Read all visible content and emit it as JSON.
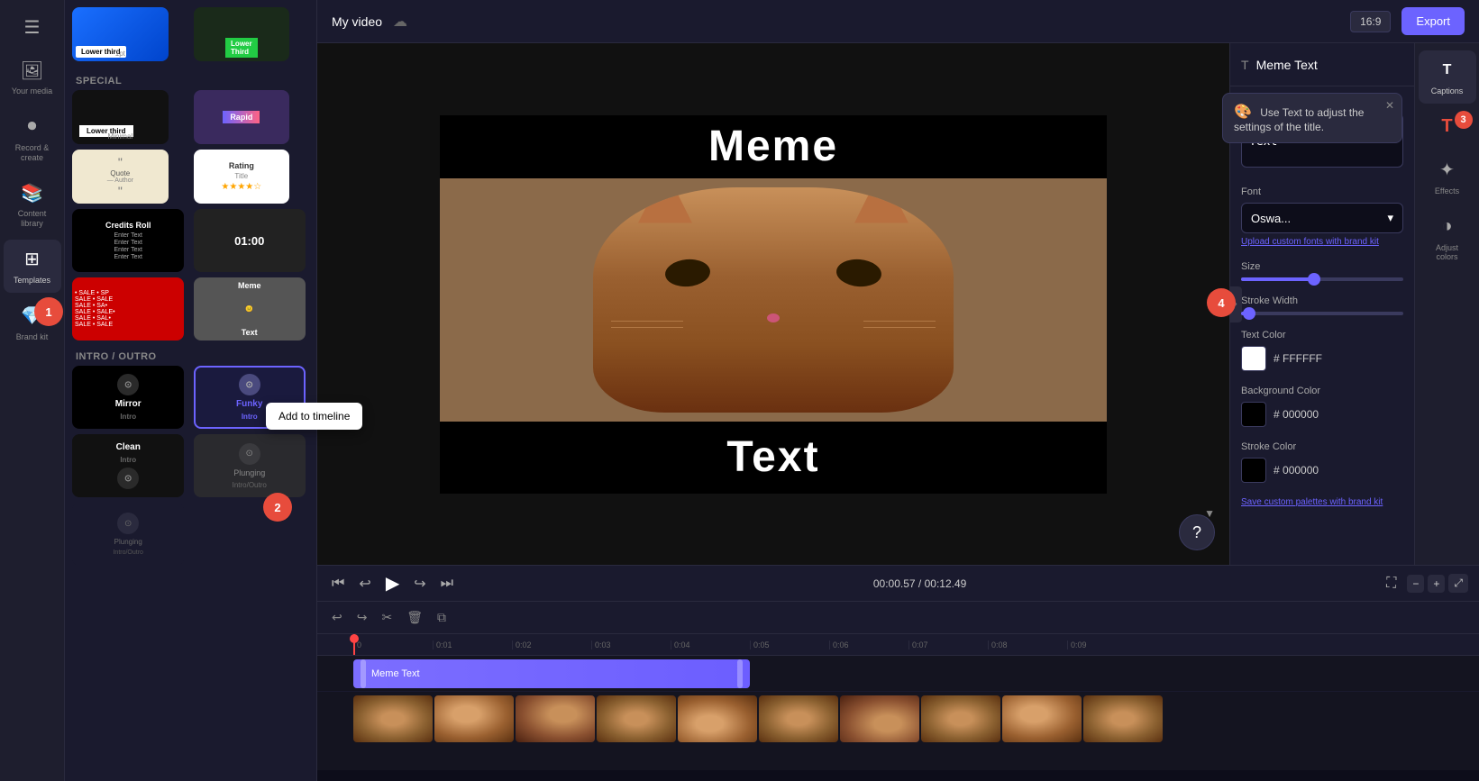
{
  "app": {
    "title": "My video",
    "export_label": "Export",
    "aspect_ratio": "16:9"
  },
  "sidebar": {
    "items": [
      {
        "id": "menu",
        "icon": "☰",
        "label": ""
      },
      {
        "id": "your-media",
        "icon": "🖼",
        "label": "Your media"
      },
      {
        "id": "record",
        "icon": "⏺",
        "label": "Record &\ncreate"
      },
      {
        "id": "content-library",
        "icon": "📚",
        "label": "Content\nlibrary"
      },
      {
        "id": "templates",
        "icon": "⊞",
        "label": "Templates",
        "active": true
      },
      {
        "id": "brand-kit",
        "icon": "💎",
        "label": "Brand kit"
      }
    ]
  },
  "templates_panel": {
    "sections": [
      {
        "id": "special",
        "label": "Special",
        "cards": [
          {
            "id": "lower-third-1",
            "type": "lower-third-blue",
            "title": "Lower third"
          },
          {
            "id": "lower-third-2",
            "type": "lower-third-green",
            "title": "Lower third"
          },
          {
            "id": "lower-third-3",
            "type": "lower-third-white",
            "title": "Lower third"
          },
          {
            "id": "rapid",
            "type": "rapid",
            "title": "Rapid"
          }
        ]
      },
      {
        "id": "special2",
        "label": "",
        "cards": [
          {
            "id": "quote-author",
            "type": "quote",
            "title": "Quote Author"
          },
          {
            "id": "rating",
            "type": "rating",
            "title": "Rating"
          },
          {
            "id": "credits-roll",
            "type": "credits",
            "title": "Credits Roll",
            "sub": ""
          },
          {
            "id": "timer",
            "type": "timer",
            "title": "01:00"
          }
        ]
      },
      {
        "id": "special3",
        "label": "",
        "cards": [
          {
            "id": "sale",
            "type": "sale",
            "title": "• SALE •"
          },
          {
            "id": "meme",
            "type": "meme",
            "title": "Meme"
          }
        ]
      },
      {
        "id": "intro-outro",
        "label": "Intro / Outro",
        "cards": [
          {
            "id": "mirror-intro",
            "type": "mirror",
            "title": "Mirror",
            "sub": "Intro"
          },
          {
            "id": "funky-intro",
            "type": "funky",
            "title": "Funky",
            "sub": "Intro",
            "selected": true
          },
          {
            "id": "clean-intro",
            "type": "clean",
            "title": "Clean",
            "sub": "Intro"
          },
          {
            "id": "plunging-intro",
            "type": "plunging",
            "title": "Plunging",
            "sub": "Intro/Outro"
          }
        ]
      },
      {
        "id": "intro-outro2",
        "label": "",
        "cards": [
          {
            "id": "plunging-intro2",
            "type": "plunging2",
            "title": "Plunging",
            "sub": "Intro/Outro"
          }
        ]
      }
    ]
  },
  "video": {
    "top_text": "Meme",
    "bottom_text": "Text",
    "time_current": "00:00.57",
    "time_total": "00:12.49"
  },
  "timeline": {
    "meme_text_clip": "Meme Text",
    "ruler_marks": [
      "0",
      "0:01",
      "0:02",
      "0:03",
      "0:04",
      "0:05",
      "0:06",
      "0:07",
      "0:08",
      "0:09"
    ],
    "zoom_in_icon": "+",
    "zoom_out_icon": "-"
  },
  "right_panel": {
    "title": "Meme Text",
    "tooltip": {
      "text": "Use Text to adjust the settings of the title.",
      "emoji": "🎨"
    },
    "sections": {
      "text": {
        "label": "Text",
        "value": "Meme\nText"
      },
      "font": {
        "label": "Font",
        "value": "Oswa...",
        "upload_link": "Upload custom fonts",
        "brand_kit_text": "with brand kit"
      },
      "size": {
        "label": "Size",
        "slider_percent": 45
      },
      "stroke_width": {
        "label": "Stroke Width",
        "slider_percent": 5
      },
      "text_color": {
        "label": "Text Color",
        "color": "#ffffff",
        "hex": "FFFFFF"
      },
      "background_color": {
        "label": "Background Color",
        "color": "#000000",
        "hex": "000000"
      },
      "stroke_color": {
        "label": "Stroke Color",
        "color": "#000000",
        "hex": "000000"
      },
      "save_palettes": "Save custom palettes",
      "with_brand_kit": "with brand kit"
    }
  },
  "right_icon_bar": {
    "items": [
      {
        "id": "captions",
        "icon": "T",
        "label": "Captions"
      },
      {
        "id": "text",
        "icon": "T",
        "label": ""
      },
      {
        "id": "effects",
        "icon": "✦",
        "label": "Effects"
      },
      {
        "id": "adjust-colors",
        "icon": "◑",
        "label": "Adjust\ncolors"
      }
    ]
  },
  "controls": {
    "prev": "⏮",
    "back5": "↩",
    "play": "▶",
    "fwd5": "↪",
    "next": "⏭",
    "fullscreen": "⛶"
  },
  "toolbar": {
    "undo": "↩",
    "redo": "↪",
    "cut": "✂",
    "delete": "🗑",
    "duplicate": "⧉"
  },
  "add_timeline_popup": "Add to timeline",
  "annotations": [
    {
      "number": "1",
      "style": "cursor"
    },
    {
      "number": "2",
      "style": "bubble"
    },
    {
      "number": "3",
      "style": "bubble"
    },
    {
      "number": "4",
      "style": "bubble"
    }
  ]
}
